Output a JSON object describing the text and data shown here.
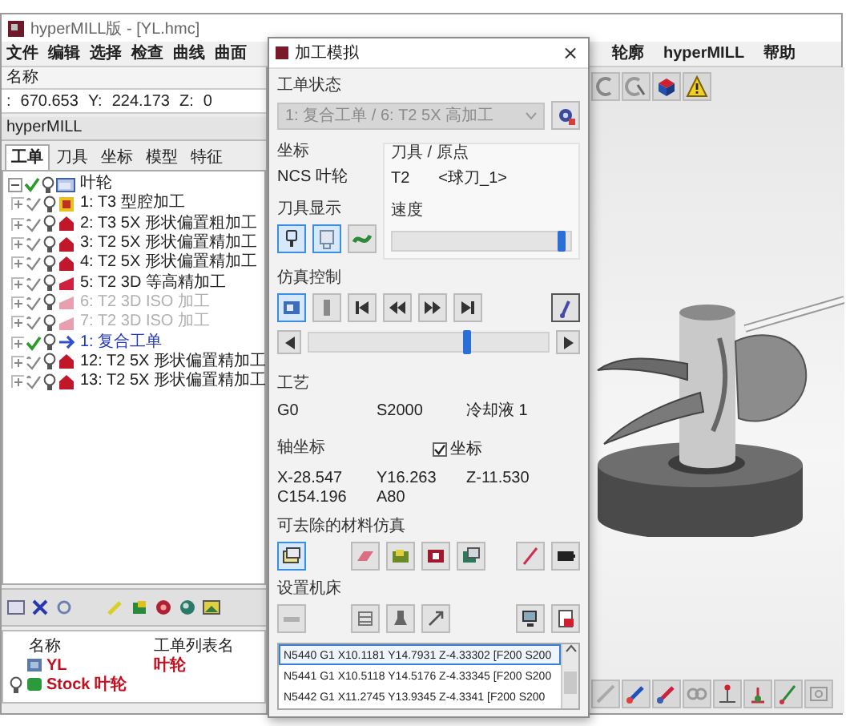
{
  "window": {
    "title": "hyperMILL版 - [YL.hmc]"
  },
  "menu": {
    "left": [
      "文件",
      "编辑",
      "选择",
      "检查",
      "曲线",
      "曲面"
    ],
    "right": [
      "轮廓",
      "hyperMILL",
      "帮助"
    ]
  },
  "name_bar": {
    "label": "名称"
  },
  "coordinates": [
    {
      "label": ":",
      "value": "670.653"
    },
    {
      "label": "Y:",
      "value": "224.173"
    },
    {
      "label": "Z:",
      "value": "0"
    }
  ],
  "panel_title": "hyperMILL",
  "tabs": [
    {
      "label": "工单",
      "selected": true
    },
    {
      "label": "刀具",
      "selected": false
    },
    {
      "label": "坐标",
      "selected": false
    },
    {
      "label": "模型",
      "selected": false
    },
    {
      "label": "特征",
      "selected": false
    }
  ],
  "tree": {
    "label": "叶轮",
    "expanded": true,
    "children": [
      {
        "label": "1: T3 型腔加工",
        "kind": "pocket",
        "disabled": false
      },
      {
        "label": "2: T3 5X 形状偏置粗加工",
        "kind": "offset",
        "disabled": false
      },
      {
        "label": "3: T2 5X 形状偏置精加工",
        "kind": "offset",
        "disabled": false
      },
      {
        "label": "4: T2 5X 形状偏置精加工",
        "kind": "offset",
        "disabled": false
      },
      {
        "label": "5: T2 3D 等高精加工",
        "kind": "contour",
        "disabled": false
      },
      {
        "label": "6: T2 3D ISO 加工",
        "kind": "iso",
        "disabled": true
      },
      {
        "label": "7: T2 3D ISO 加工",
        "kind": "iso",
        "disabled": true
      },
      {
        "label": "1: 复合工单",
        "kind": "compound",
        "disabled": false
      },
      {
        "label": "12: T2 5X 形状偏置精加工",
        "kind": "offset",
        "disabled": false
      },
      {
        "label": "13: T2 5X 形状偏置精加工",
        "kind": "offset",
        "disabled": false
      }
    ]
  },
  "object_table": {
    "columns": [
      "名称",
      "工单列表名"
    ],
    "rows": [
      {
        "cells": [
          "YL",
          "叶轮"
        ]
      },
      {
        "cells": [
          "Stock 叶轮"
        ]
      }
    ]
  },
  "dialog": {
    "title": "加工模拟",
    "close": "×",
    "job_status": {
      "label": "工单状态",
      "value": "1: 复合工单 / 6: T2 5X 高加工",
      "disabled": true
    },
    "coordinates": {
      "label": "坐标",
      "value": "NCS 叶轮"
    },
    "tool": {
      "label": "刀具 / 原点",
      "number": "T2",
      "name": "<球刀_1>"
    },
    "tool_display": {
      "label": "刀具显示",
      "buttons": [
        {
          "on": true
        },
        {
          "on": true
        },
        {
          "on": false
        }
      ]
    },
    "speed": {
      "label": "速度",
      "level": 0.97
    },
    "sim_control": {
      "label": "仿真控制",
      "buttons": [
        {
          "on": true
        },
        {
          "on": false
        },
        {
          "on": false
        },
        {
          "on": false
        },
        {
          "on": false
        },
        {
          "on": false
        },
        {
          "on": false
        }
      ]
    },
    "progress": {
      "level": 0.66
    },
    "process": {
      "label": "工艺",
      "values": [
        "G0",
        "S2000",
        "冷却液 1"
      ]
    },
    "axes": {
      "label": "轴坐标",
      "checkbox": {
        "label": "坐标",
        "checked": true
      },
      "values": [
        "X-28.547",
        "Y16.263",
        "Z-11.530",
        "C154.196",
        "A80"
      ]
    },
    "material": {
      "label": "可去除的材料仿真",
      "buttons": [
        {
          "on": true
        },
        {
          "on": false
        },
        {
          "on": false
        },
        {
          "on": false
        },
        {
          "on": false
        },
        {
          "on": false
        },
        {
          "on": false
        }
      ]
    },
    "machine": {
      "label": "设置机床",
      "buttons": [
        {
          "on": false
        },
        {
          "on": false
        },
        {
          "on": false
        },
        {
          "on": false
        },
        {
          "on": false
        },
        {
          "on": false
        }
      ]
    },
    "nc_lines": [
      {
        "text": "N5440 G1 X10.1181 Y14.7931 Z-4.33302 [F200 S200",
        "selected": true
      },
      {
        "text": "N5441 G1 X10.5118 Y14.5176 Z-4.33345 [F200 S200",
        "selected": false
      },
      {
        "text": "N5442 G1 X11.2745 Y13.9345 Z-4.3341 [F200 S200",
        "selected": false
      }
    ]
  }
}
